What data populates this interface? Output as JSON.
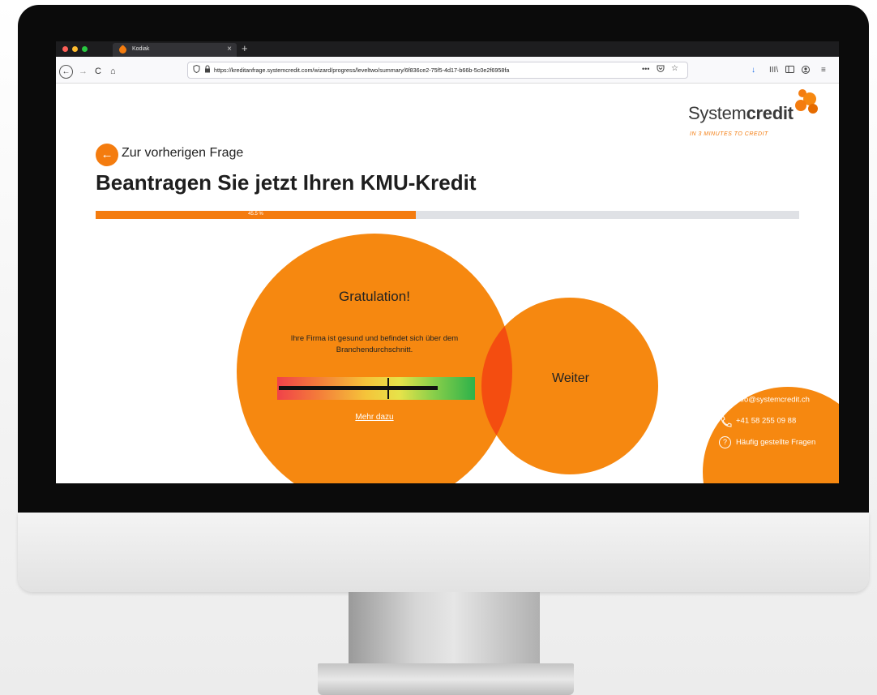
{
  "browser": {
    "tab_title": "Kodiak",
    "tab_close": "×",
    "new_tab": "+",
    "url": "https://kreditanfrage.systemcredit.com/wizard/progress/leveltwo/summary/6f836ce2-75f5-4d17-b66b-5c0e2f6958fa",
    "url_more": "•••",
    "back_icon": "←",
    "forward_icon": "→",
    "reload_icon": "C",
    "home_icon": "⌂",
    "star_icon": "☆",
    "menu_icon": "≡",
    "download_icon": "↓",
    "library_icon": "III\\"
  },
  "brand": {
    "name_light": "System",
    "name_bold": "credit",
    "tagline": "IN 3 MINUTES TO CREDIT",
    "accent_color": "#f47c0f"
  },
  "nav": {
    "back_arrow": "←",
    "back_label": "Zur vorherigen Frage"
  },
  "page": {
    "title": "Beantragen Sie jetzt Ihren KMU-Kredit"
  },
  "progress": {
    "percent": 45.5,
    "label": "45.5 %"
  },
  "result": {
    "heading": "Gratulation!",
    "text": "Ihre Firma ist gesund und befindet sich über dem Branchendurchschnitt.",
    "gauge_level": 0.56,
    "more_link": "Mehr dazu"
  },
  "next_button": {
    "label": "Weiter"
  },
  "contact": {
    "email": "info@systemcredit.ch",
    "phone": "+41 58 255 09 88",
    "faq": "Häufig gestellte Fragen",
    "faq_icon": "?"
  }
}
